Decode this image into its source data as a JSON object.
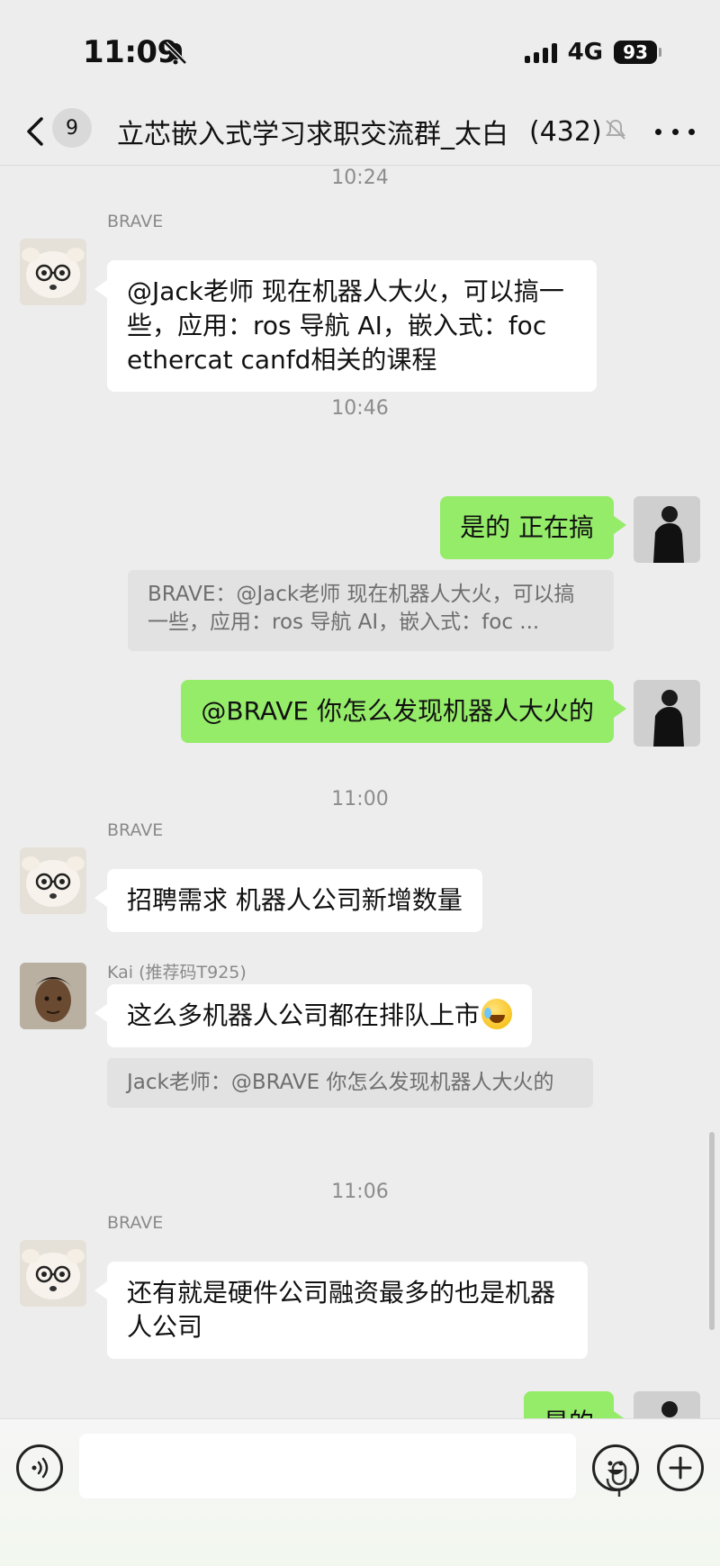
{
  "status_bar": {
    "time": "11:09",
    "network": "4G",
    "battery": "93"
  },
  "nav": {
    "back_badge": "9",
    "title": "立芯嵌入式学习求职交流群_太白",
    "member_count": "(432)"
  },
  "messages": [
    {
      "type": "timestamp",
      "text": "10:24"
    },
    {
      "type": "incoming",
      "sender": "BRAVE",
      "text": "@Jack老师 现在机器人大火，可以搞一些，应用：ros 导航 AI，嵌入式：foc ethercat canfd相关的课程"
    },
    {
      "type": "timestamp",
      "text": "10:46"
    },
    {
      "type": "outgoing",
      "text": "是的 正在搞"
    },
    {
      "type": "quote",
      "text": "BRAVE：@Jack老师 现在机器人大火，可以搞一些，应用：ros 导航 AI，嵌入式：foc ..."
    },
    {
      "type": "outgoing",
      "text": "@BRAVE 你怎么发现机器人大火的"
    },
    {
      "type": "timestamp",
      "text": "11:00"
    },
    {
      "type": "incoming",
      "sender": "BRAVE",
      "text": "招聘需求 机器人公司新增数量"
    },
    {
      "type": "incoming",
      "sender": "Kai (推荐码T925)",
      "text": "这么多机器人公司都在排队上市"
    },
    {
      "type": "quote",
      "text": "Jack老师：@BRAVE 你怎么发现机器人大火的"
    },
    {
      "type": "timestamp",
      "text": "11:06"
    },
    {
      "type": "incoming",
      "sender": "BRAVE",
      "text": "还有就是硬件公司融资最多的也是机器人公司"
    },
    {
      "type": "outgoing",
      "text": "是的"
    }
  ],
  "input_bar": {
    "placeholder": ""
  },
  "colors": {
    "background": "#ededed",
    "outgoing_bubble": "#95ec69",
    "incoming_bubble": "#ffffff",
    "quote_bg": "#e2e2e2"
  },
  "icons": [
    "bell-slash-icon",
    "signal-icon",
    "battery-icon",
    "back-chevron-icon",
    "mute-icon",
    "more-icon",
    "voice-icon",
    "microphone-icon",
    "emoji-icon",
    "plus-icon",
    "laughing-emoji-icon"
  ]
}
